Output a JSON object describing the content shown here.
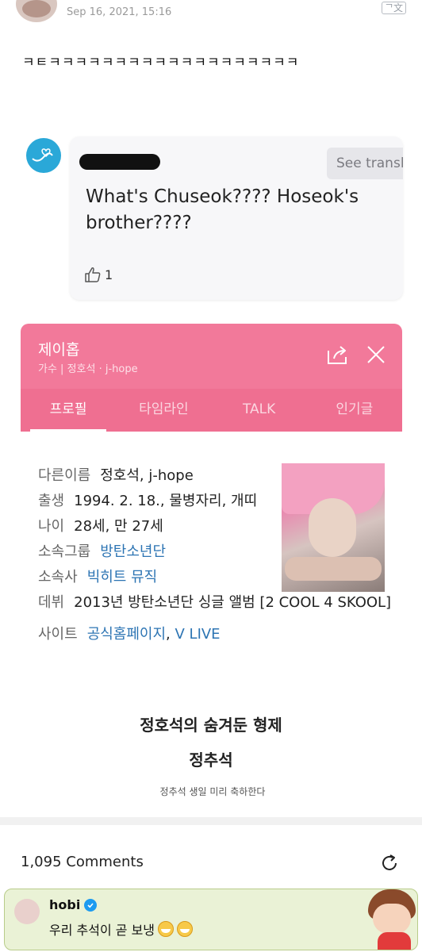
{
  "post": {
    "date": "Sep 16, 2021, 15:16",
    "text": "ㅋㅌㅋㅋㅋㅋㅋㅋㅋㅋㅋㅋㅋㅋㅋㅋㅋㅋㅋㅋㅋ"
  },
  "embedded_comment": {
    "see_translation": "See transl",
    "text": "What's Chuseok???? Hoseok's brother????",
    "likes": "1"
  },
  "profile_card": {
    "name": "제이홉",
    "subtitle": "가수 | 정호석 · j-hope",
    "tabs": [
      "프로필",
      "타임라인",
      "TALK",
      "인기글"
    ],
    "info": {
      "other_name_label": "다른이름",
      "other_name": "정호석, j-hope",
      "birth_label": "출생",
      "birth": "1994. 2. 18., 물병자리, 개띠",
      "age_label": "나이",
      "age": "28세, 만 27세",
      "group_label": "소속그룹",
      "group": "방탄소년단",
      "agency_label": "소속사",
      "agency": "빅히트 뮤직",
      "debut_label": "데뷔",
      "debut": "2013년 방탄소년단 싱글 앨범 [2 COOL 4 SKOOL]",
      "site_label": "사이트",
      "site_official": "공식홈페이지",
      "site_vlive": "V LIVE"
    }
  },
  "hidden": {
    "title": "정호석의 숨겨둔 형제",
    "name": "정추석",
    "note": "정추석 생일 미리 축하한다"
  },
  "comments": {
    "count": "1,095 Comments"
  },
  "reply": {
    "user": "hobi",
    "text": "우리 추석이 곧 보냉"
  },
  "colors": {
    "pink_header": "#f2799a",
    "tab_bar": "#ef6f91",
    "link": "#2c74b3",
    "reply_bg": "#eaf2d6"
  }
}
